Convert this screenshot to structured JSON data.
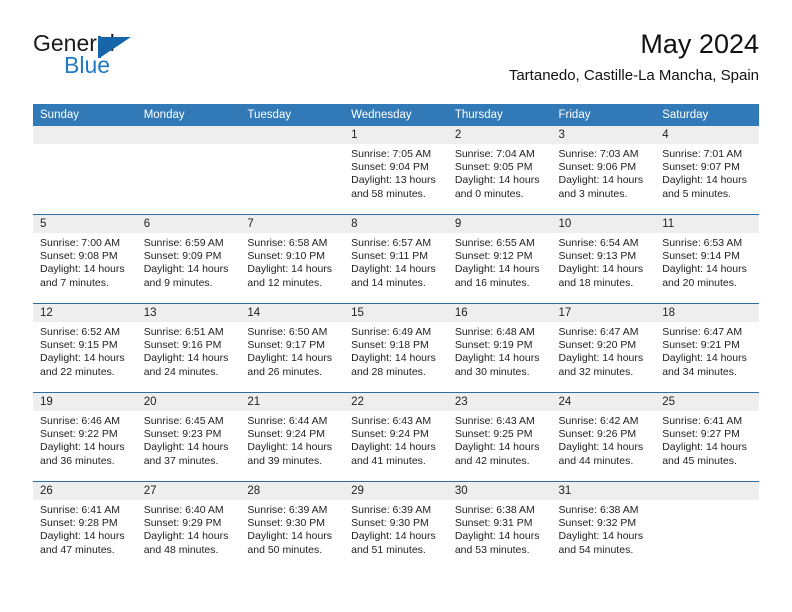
{
  "brand": {
    "name_part1": "General",
    "name_part2": "Blue",
    "flag_icon": "blue-flag-icon"
  },
  "header": {
    "month_title": "May 2024",
    "location": "Tartanedo, Castille-La Mancha, Spain"
  },
  "colors": {
    "header_blue": "#3279b7",
    "row_separator_blue": "#2e6da4",
    "daynum_band_gray": "#eeeeee",
    "brand_blue": "#1f7ac4",
    "text": "#222222"
  },
  "weekday_headers": [
    "Sunday",
    "Monday",
    "Tuesday",
    "Wednesday",
    "Thursday",
    "Friday",
    "Saturday"
  ],
  "labels": {
    "sunrise_prefix": "Sunrise:",
    "sunset_prefix": "Sunset:",
    "daylight_prefix": "Daylight:"
  },
  "weeks": [
    [
      {
        "empty": true
      },
      {
        "empty": true
      },
      {
        "empty": true
      },
      {
        "day": "1",
        "sunrise": "Sunrise: 7:05 AM",
        "sunset": "Sunset: 9:04 PM",
        "daylight_l1": "Daylight: 13 hours",
        "daylight_l2": "and 58 minutes."
      },
      {
        "day": "2",
        "sunrise": "Sunrise: 7:04 AM",
        "sunset": "Sunset: 9:05 PM",
        "daylight_l1": "Daylight: 14 hours",
        "daylight_l2": "and 0 minutes."
      },
      {
        "day": "3",
        "sunrise": "Sunrise: 7:03 AM",
        "sunset": "Sunset: 9:06 PM",
        "daylight_l1": "Daylight: 14 hours",
        "daylight_l2": "and 3 minutes."
      },
      {
        "day": "4",
        "sunrise": "Sunrise: 7:01 AM",
        "sunset": "Sunset: 9:07 PM",
        "daylight_l1": "Daylight: 14 hours",
        "daylight_l2": "and 5 minutes."
      }
    ],
    [
      {
        "day": "5",
        "sunrise": "Sunrise: 7:00 AM",
        "sunset": "Sunset: 9:08 PM",
        "daylight_l1": "Daylight: 14 hours",
        "daylight_l2": "and 7 minutes."
      },
      {
        "day": "6",
        "sunrise": "Sunrise: 6:59 AM",
        "sunset": "Sunset: 9:09 PM",
        "daylight_l1": "Daylight: 14 hours",
        "daylight_l2": "and 9 minutes."
      },
      {
        "day": "7",
        "sunrise": "Sunrise: 6:58 AM",
        "sunset": "Sunset: 9:10 PM",
        "daylight_l1": "Daylight: 14 hours",
        "daylight_l2": "and 12 minutes."
      },
      {
        "day": "8",
        "sunrise": "Sunrise: 6:57 AM",
        "sunset": "Sunset: 9:11 PM",
        "daylight_l1": "Daylight: 14 hours",
        "daylight_l2": "and 14 minutes."
      },
      {
        "day": "9",
        "sunrise": "Sunrise: 6:55 AM",
        "sunset": "Sunset: 9:12 PM",
        "daylight_l1": "Daylight: 14 hours",
        "daylight_l2": "and 16 minutes."
      },
      {
        "day": "10",
        "sunrise": "Sunrise: 6:54 AM",
        "sunset": "Sunset: 9:13 PM",
        "daylight_l1": "Daylight: 14 hours",
        "daylight_l2": "and 18 minutes."
      },
      {
        "day": "11",
        "sunrise": "Sunrise: 6:53 AM",
        "sunset": "Sunset: 9:14 PM",
        "daylight_l1": "Daylight: 14 hours",
        "daylight_l2": "and 20 minutes."
      }
    ],
    [
      {
        "day": "12",
        "sunrise": "Sunrise: 6:52 AM",
        "sunset": "Sunset: 9:15 PM",
        "daylight_l1": "Daylight: 14 hours",
        "daylight_l2": "and 22 minutes."
      },
      {
        "day": "13",
        "sunrise": "Sunrise: 6:51 AM",
        "sunset": "Sunset: 9:16 PM",
        "daylight_l1": "Daylight: 14 hours",
        "daylight_l2": "and 24 minutes."
      },
      {
        "day": "14",
        "sunrise": "Sunrise: 6:50 AM",
        "sunset": "Sunset: 9:17 PM",
        "daylight_l1": "Daylight: 14 hours",
        "daylight_l2": "and 26 minutes."
      },
      {
        "day": "15",
        "sunrise": "Sunrise: 6:49 AM",
        "sunset": "Sunset: 9:18 PM",
        "daylight_l1": "Daylight: 14 hours",
        "daylight_l2": "and 28 minutes."
      },
      {
        "day": "16",
        "sunrise": "Sunrise: 6:48 AM",
        "sunset": "Sunset: 9:19 PM",
        "daylight_l1": "Daylight: 14 hours",
        "daylight_l2": "and 30 minutes."
      },
      {
        "day": "17",
        "sunrise": "Sunrise: 6:47 AM",
        "sunset": "Sunset: 9:20 PM",
        "daylight_l1": "Daylight: 14 hours",
        "daylight_l2": "and 32 minutes."
      },
      {
        "day": "18",
        "sunrise": "Sunrise: 6:47 AM",
        "sunset": "Sunset: 9:21 PM",
        "daylight_l1": "Daylight: 14 hours",
        "daylight_l2": "and 34 minutes."
      }
    ],
    [
      {
        "day": "19",
        "sunrise": "Sunrise: 6:46 AM",
        "sunset": "Sunset: 9:22 PM",
        "daylight_l1": "Daylight: 14 hours",
        "daylight_l2": "and 36 minutes."
      },
      {
        "day": "20",
        "sunrise": "Sunrise: 6:45 AM",
        "sunset": "Sunset: 9:23 PM",
        "daylight_l1": "Daylight: 14 hours",
        "daylight_l2": "and 37 minutes."
      },
      {
        "day": "21",
        "sunrise": "Sunrise: 6:44 AM",
        "sunset": "Sunset: 9:24 PM",
        "daylight_l1": "Daylight: 14 hours",
        "daylight_l2": "and 39 minutes."
      },
      {
        "day": "22",
        "sunrise": "Sunrise: 6:43 AM",
        "sunset": "Sunset: 9:24 PM",
        "daylight_l1": "Daylight: 14 hours",
        "daylight_l2": "and 41 minutes."
      },
      {
        "day": "23",
        "sunrise": "Sunrise: 6:43 AM",
        "sunset": "Sunset: 9:25 PM",
        "daylight_l1": "Daylight: 14 hours",
        "daylight_l2": "and 42 minutes."
      },
      {
        "day": "24",
        "sunrise": "Sunrise: 6:42 AM",
        "sunset": "Sunset: 9:26 PM",
        "daylight_l1": "Daylight: 14 hours",
        "daylight_l2": "and 44 minutes."
      },
      {
        "day": "25",
        "sunrise": "Sunrise: 6:41 AM",
        "sunset": "Sunset: 9:27 PM",
        "daylight_l1": "Daylight: 14 hours",
        "daylight_l2": "and 45 minutes."
      }
    ],
    [
      {
        "day": "26",
        "sunrise": "Sunrise: 6:41 AM",
        "sunset": "Sunset: 9:28 PM",
        "daylight_l1": "Daylight: 14 hours",
        "daylight_l2": "and 47 minutes."
      },
      {
        "day": "27",
        "sunrise": "Sunrise: 6:40 AM",
        "sunset": "Sunset: 9:29 PM",
        "daylight_l1": "Daylight: 14 hours",
        "daylight_l2": "and 48 minutes."
      },
      {
        "day": "28",
        "sunrise": "Sunrise: 6:39 AM",
        "sunset": "Sunset: 9:30 PM",
        "daylight_l1": "Daylight: 14 hours",
        "daylight_l2": "and 50 minutes."
      },
      {
        "day": "29",
        "sunrise": "Sunrise: 6:39 AM",
        "sunset": "Sunset: 9:30 PM",
        "daylight_l1": "Daylight: 14 hours",
        "daylight_l2": "and 51 minutes."
      },
      {
        "day": "30",
        "sunrise": "Sunrise: 6:38 AM",
        "sunset": "Sunset: 9:31 PM",
        "daylight_l1": "Daylight: 14 hours",
        "daylight_l2": "and 53 minutes."
      },
      {
        "day": "31",
        "sunrise": "Sunrise: 6:38 AM",
        "sunset": "Sunset: 9:32 PM",
        "daylight_l1": "Daylight: 14 hours",
        "daylight_l2": "and 54 minutes."
      },
      {
        "empty": true
      }
    ]
  ]
}
